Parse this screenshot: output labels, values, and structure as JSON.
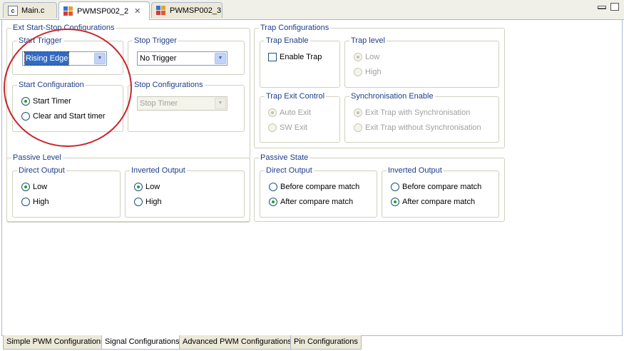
{
  "editor_tabs": [
    {
      "label": "Main.c",
      "icon": "c-file-icon"
    },
    {
      "label": "PWMSP002_2",
      "icon": "app-config-icon",
      "active": true
    },
    {
      "label": "PWMSP002_3",
      "icon": "app-config-icon"
    }
  ],
  "ext_start_stop": {
    "title": "Ext Start-Stop Configurations",
    "start_trigger": {
      "title": "Start Trigger",
      "value": "Rising Edge"
    },
    "stop_trigger": {
      "title": "Stop Trigger",
      "value": "No Trigger"
    },
    "start_configuration": {
      "title": "Start Configuration",
      "options": [
        "Start Timer",
        "Clear and Start timer"
      ],
      "selected": 0
    },
    "stop_configurations": {
      "title": "Stop Configurations",
      "value": "Stop Timer"
    }
  },
  "trap": {
    "title": "Trap Configurations",
    "enable": {
      "title": "Trap Enable",
      "label": "Enable Trap",
      "checked": false
    },
    "level": {
      "title": "Trap level",
      "options": [
        "Low",
        "High"
      ],
      "selected": 0
    },
    "exit_control": {
      "title": "Trap Exit Control",
      "options": [
        "Auto Exit",
        "SW Exit"
      ],
      "selected": 0
    },
    "sync_enable": {
      "title": "Synchronisation Enable",
      "options": [
        "Exit Trap with Synchronisation",
        "Exit Trap without Synchronisation"
      ],
      "selected": 0
    }
  },
  "passive_level": {
    "title": "Passive Level",
    "direct": {
      "title": "Direct Output",
      "options": [
        "Low",
        "High"
      ],
      "selected": 0
    },
    "inverted": {
      "title": "Inverted Output",
      "options": [
        "Low",
        "High"
      ],
      "selected": 0
    }
  },
  "passive_state": {
    "title": "Passive State",
    "direct": {
      "title": "Direct Output",
      "options": [
        "Before compare match",
        "After compare match"
      ],
      "selected": 1
    },
    "inverted": {
      "title": "Inverted Output",
      "options": [
        "Before compare match",
        "After compare match"
      ],
      "selected": 1
    }
  },
  "bottom_tabs": [
    {
      "label": "Simple PWM Configurations"
    },
    {
      "label": "Signal Configurations",
      "active": true
    },
    {
      "label": "Advanced PWM Configurations"
    },
    {
      "label": "Pin Configurations"
    }
  ],
  "colors": {
    "legend": "#1f3d8a",
    "annotation": "#c8262b",
    "radio_dot": "#21a121"
  }
}
